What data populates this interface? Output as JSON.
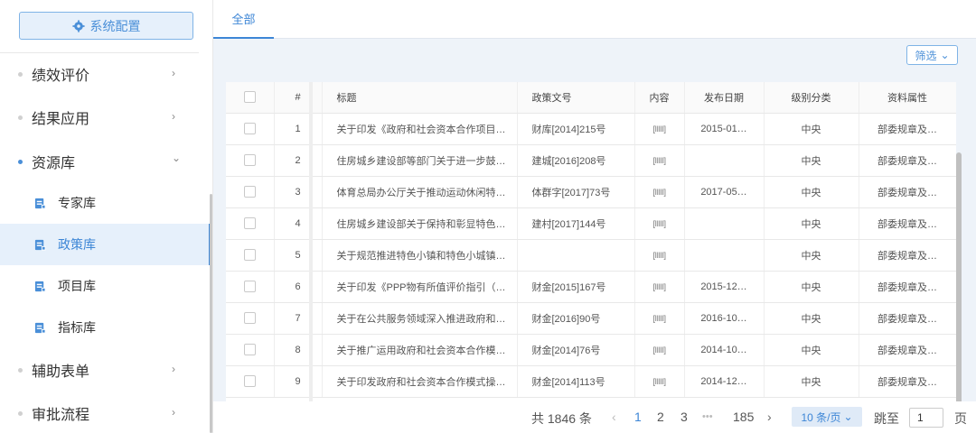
{
  "sidebar": {
    "config_button": "系统配置",
    "menu": [
      {
        "label": "绩效评价",
        "chevron": "›"
      },
      {
        "label": "结果应用",
        "chevron": "›"
      },
      {
        "label": "资源库",
        "chevron": "⌄"
      },
      {
        "label": "辅助表单",
        "chevron": "›"
      },
      {
        "label": "审批流程",
        "chevron": "›"
      }
    ],
    "sub_items": [
      {
        "label": "专家库"
      },
      {
        "label": "政策库"
      },
      {
        "label": "项目库"
      },
      {
        "label": "指标库"
      }
    ]
  },
  "tabs": {
    "all": "全部"
  },
  "filter_button": "筛选",
  "filter_chevron": "⌄",
  "table": {
    "headers": [
      "#",
      "标题",
      "政策文号",
      "内容",
      "发布日期",
      "级别分类",
      "资料属性"
    ],
    "rows": [
      {
        "n": "1",
        "title": "关于印发《政府和社会资本合作项目…",
        "doc_no": "财库[2014]215号",
        "content": "[IIIII]",
        "date": "2015-01…",
        "level": "中央",
        "attr": "部委规章及…"
      },
      {
        "n": "2",
        "title": "住房城乡建设部等部门关于进一步鼓…",
        "doc_no": "建城[2016]208号",
        "content": "[IIIII]",
        "date": "",
        "level": "中央",
        "attr": "部委规章及…"
      },
      {
        "n": "3",
        "title": "体育总局办公厅关于推动运动休闲特…",
        "doc_no": "体群字[2017]73号",
        "content": "[IIIII]",
        "date": "2017-05…",
        "level": "中央",
        "attr": "部委规章及…"
      },
      {
        "n": "4",
        "title": "住房城乡建设部关于保持和彰显特色…",
        "doc_no": "建村[2017]144号",
        "content": "[IIIII]",
        "date": "",
        "level": "中央",
        "attr": "部委规章及…"
      },
      {
        "n": "5",
        "title": "关于规范推进特色小镇和特色小城镇…",
        "doc_no": "",
        "content": "[IIIII]",
        "date": "",
        "level": "中央",
        "attr": "部委规章及…"
      },
      {
        "n": "6",
        "title": "关于印发《PPP物有所值评价指引（…",
        "doc_no": "财金[2015]167号",
        "content": "[IIIII]",
        "date": "2015-12…",
        "level": "中央",
        "attr": "部委规章及…"
      },
      {
        "n": "7",
        "title": "关于在公共服务领域深入推进政府和…",
        "doc_no": "财金[2016]90号",
        "content": "[IIIII]",
        "date": "2016-10…",
        "level": "中央",
        "attr": "部委规章及…"
      },
      {
        "n": "8",
        "title": "关于推广运用政府和社会资本合作模…",
        "doc_no": "财金[2014]76号",
        "content": "[IIIII]",
        "date": "2014-10…",
        "level": "中央",
        "attr": "部委规章及…"
      },
      {
        "n": "9",
        "title": "关于印发政府和社会资本合作模式操…",
        "doc_no": "财金[2014]113号",
        "content": "[IIIII]",
        "date": "2014-12…",
        "level": "中央",
        "attr": "部委规章及…"
      }
    ]
  },
  "pager": {
    "total": "共 1846 条",
    "prev": "‹",
    "pages": [
      "1",
      "2",
      "3"
    ],
    "ellipsis": "•••",
    "last": "185",
    "next": "›",
    "page_size": "10 条/页",
    "page_size_chevron": "⌄",
    "jump_label": "跳至",
    "jump_value": "1",
    "page_suffix": "页"
  },
  "colors": {
    "accent": "#3d86d6",
    "panel_bg": "#eef3f9"
  }
}
